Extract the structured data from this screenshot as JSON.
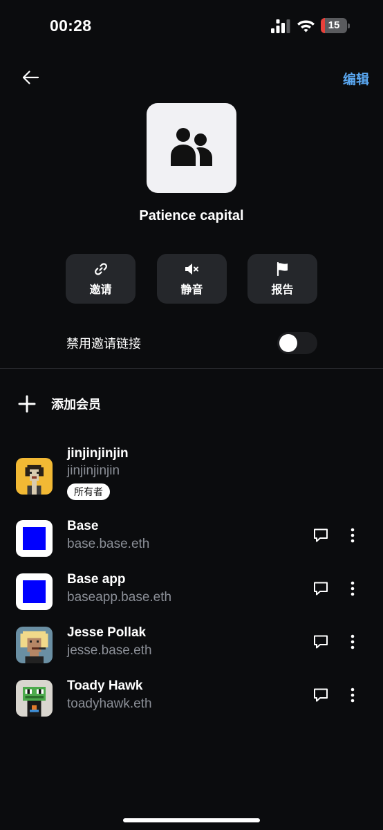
{
  "status": {
    "time": "00:28",
    "battery": "15",
    "battery_level": 0.15
  },
  "header": {
    "edit_label": "编辑"
  },
  "group": {
    "name": "Patience capital"
  },
  "actions": {
    "invite_label": "邀请",
    "mute_label": "静音",
    "report_label": "报告"
  },
  "settings": {
    "disable_invite_link_label": "禁用邀请链接",
    "disable_invite_link_on": false
  },
  "add_member": {
    "label": "添加会员"
  },
  "members": [
    {
      "name": "jinjinjinjin",
      "handle": "jinjinjinjin",
      "badge": "所有者",
      "avatar": "pixel-punk-yellow"
    },
    {
      "name": "Base",
      "handle": "base.base.eth",
      "avatar": "base-blue-square"
    },
    {
      "name": "Base app",
      "handle": "baseapp.base.eth",
      "avatar": "base-blue-square"
    },
    {
      "name": "Jesse Pollak",
      "handle": "jesse.base.eth",
      "avatar": "pixel-punk-blonde"
    },
    {
      "name": "Toady Hawk",
      "handle": "toadyhawk.eth",
      "avatar": "pixel-frog"
    }
  ],
  "colors": {
    "background": "#0b0c0e",
    "accent": "#5aa7f0",
    "button_bg": "#25272b",
    "base_blue": "#0000ff"
  }
}
